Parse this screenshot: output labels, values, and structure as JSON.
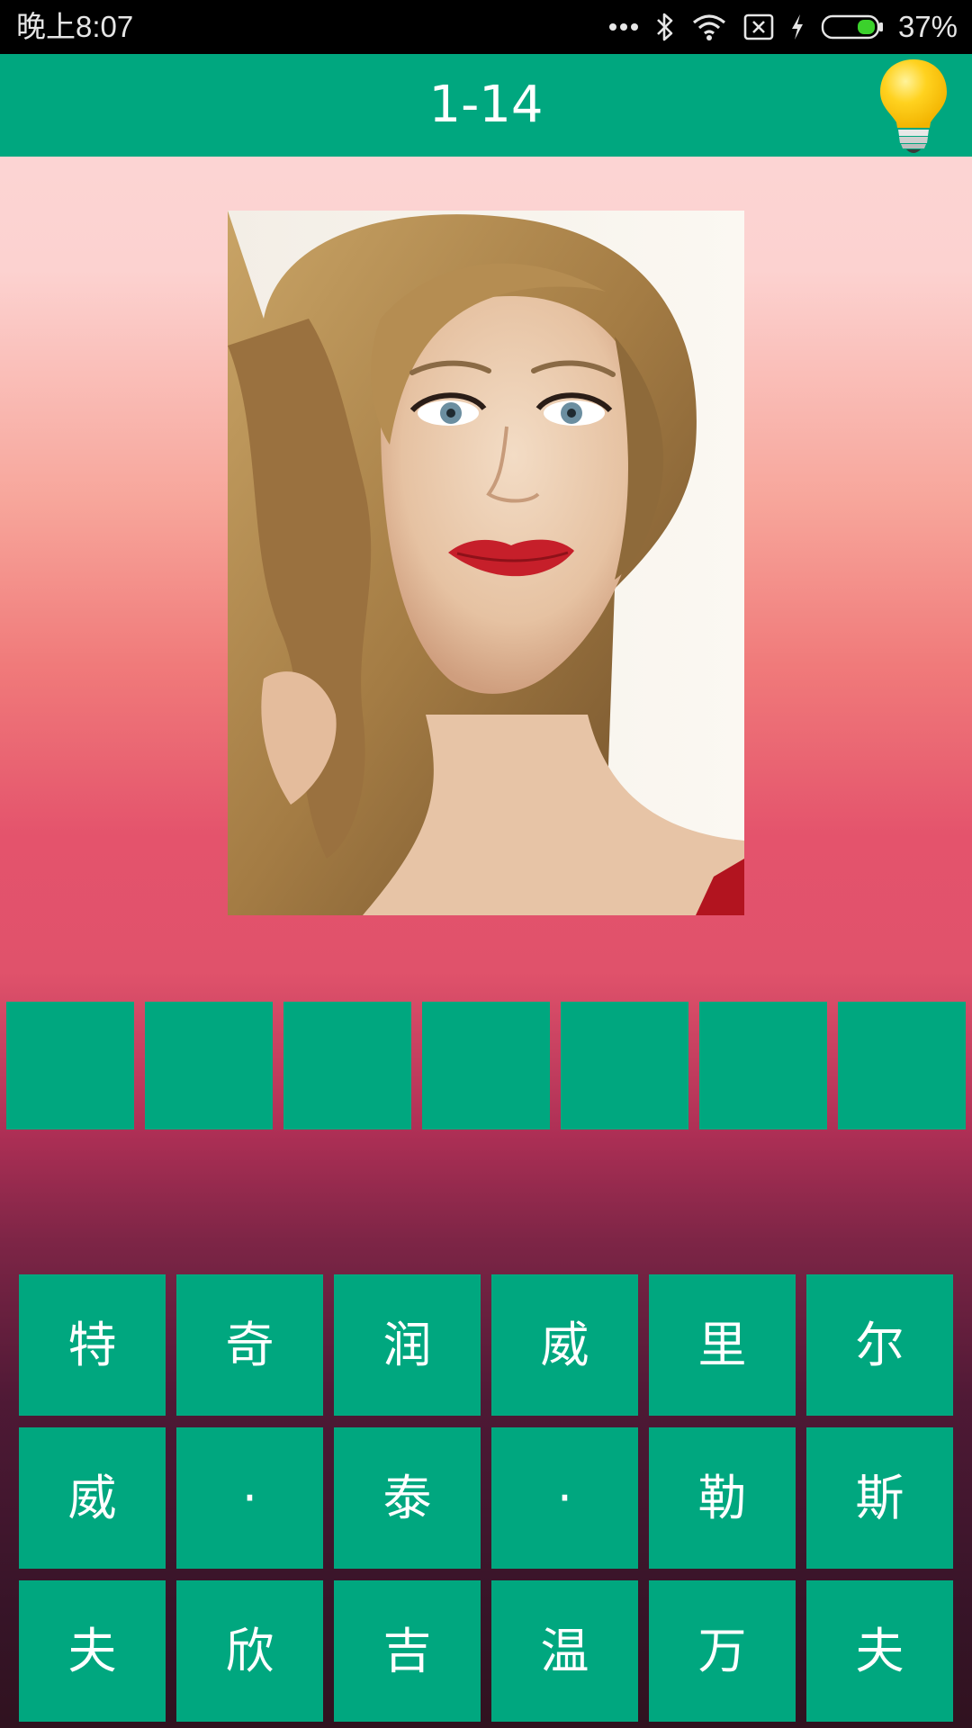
{
  "status_bar": {
    "time": "晚上8:07",
    "battery_percent": "37%",
    "icons": [
      "more-dots-icon",
      "bluetooth-icon",
      "wifi-icon",
      "no-sim-icon",
      "charging-icon",
      "battery-icon"
    ],
    "battery_level": 0.37,
    "battery_color": "#3bd12c"
  },
  "header": {
    "level": "1-14",
    "hint_icon": "lightbulb-icon",
    "background_color": "#00a77f"
  },
  "puzzle": {
    "photo": "portrait-photo",
    "answer_slots": [
      "",
      "",
      "",
      "",
      "",
      "",
      ""
    ]
  },
  "keys": [
    [
      "特",
      "奇",
      "润",
      "威",
      "里",
      "尔"
    ],
    [
      "威",
      "·",
      "泰",
      "·",
      "勒",
      "斯"
    ],
    [
      "夫",
      "欣",
      "吉",
      "温",
      "万",
      "夫"
    ]
  ],
  "colors": {
    "accent": "#00a77f",
    "hint_bulb": "#ffd21f"
  }
}
